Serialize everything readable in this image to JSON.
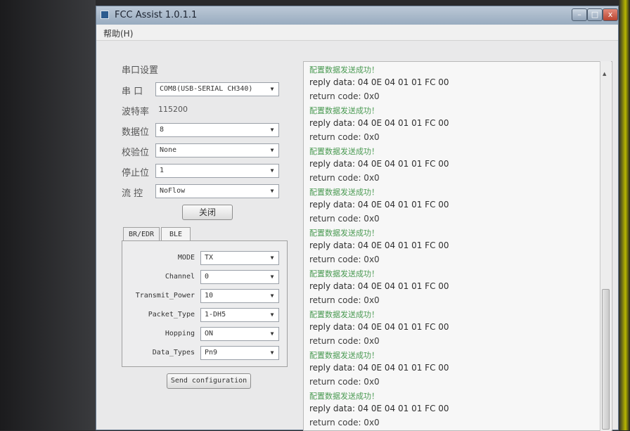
{
  "window": {
    "title": "FCC Assist 1.0.1.1",
    "controls": {
      "minimize": "–",
      "maximize": "□",
      "close": "x"
    }
  },
  "menu": {
    "help": "帮助(H)"
  },
  "serial": {
    "group_title": "串口设置",
    "port_label": "串 口",
    "port_value": "COM8(USB-SERIAL CH340)",
    "baud_label": "波特率",
    "baud_value": "115200",
    "databits_label": "数据位",
    "databits_value": "8",
    "parity_label": "校验位",
    "parity_value": "None",
    "stopbits_label": "停止位",
    "stopbits_value": "1",
    "flow_label": "流 控",
    "flow_value": "NoFlow",
    "close_button": "关闭"
  },
  "tabs": {
    "bredr": "BR/EDR",
    "ble": "BLE"
  },
  "bredr": {
    "mode_label": "MODE",
    "mode_value": "TX",
    "channel_label": "Channel",
    "channel_value": "0",
    "power_label": "Transmit_Power",
    "power_value": "10",
    "packet_label": "Packet_Type",
    "packet_value": "1-DH5",
    "hopping_label": "Hopping",
    "hopping_value": "ON",
    "datatypes_label": "Data_Types",
    "datatypes_value": "Pn9"
  },
  "send_button": "Send configuration",
  "log": {
    "success_text": "配置数据发送成功！",
    "reply_text": "reply data: 04 0E 04 01 01 FC 00",
    "code_text": "return code: 0x0"
  },
  "colors": {
    "success": "#4a9a52",
    "title_gradient_top": "#bcc9d7"
  }
}
